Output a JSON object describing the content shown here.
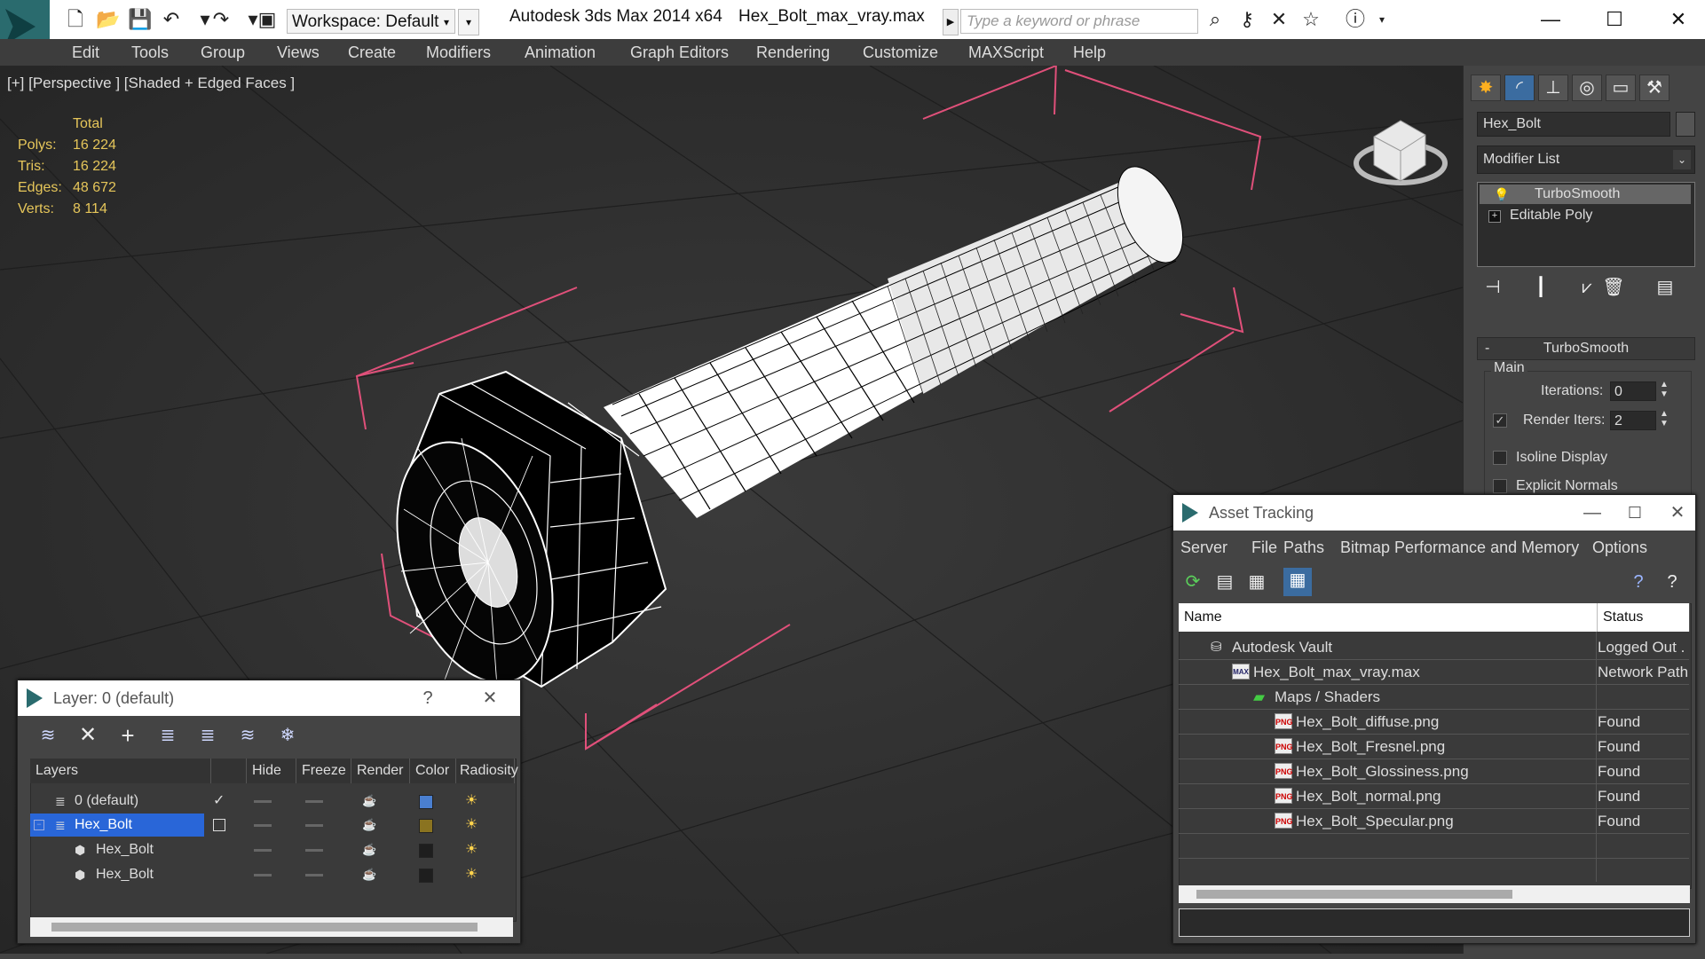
{
  "titlebar": {
    "workspace": "Workspace: Default",
    "app": "Autodesk 3ds Max  2014 x64",
    "file": "Hex_Bolt_max_vray.max",
    "search_placeholder": "Type a keyword or phrase"
  },
  "menu": [
    "Edit",
    "Tools",
    "Group",
    "Views",
    "Create",
    "Modifiers",
    "Animation",
    "Graph Editors",
    "Rendering",
    "Customize",
    "MAXScript",
    "Help"
  ],
  "viewport": {
    "label": "[+] [Perspective ] [Shaded + Edged Faces ]",
    "stats": {
      "header": "Total",
      "rows": [
        {
          "k": "Polys:",
          "v": "16 224"
        },
        {
          "k": "Tris:",
          "v": "16 224"
        },
        {
          "k": "Edges:",
          "v": "48 672"
        },
        {
          "k": "Verts:",
          "v": "8 114"
        }
      ]
    }
  },
  "cmdpanel": {
    "object_name": "Hex_Bolt",
    "modifier_list": "Modifier List",
    "stack": [
      "TurboSmooth",
      "Editable Poly"
    ],
    "rollout": "TurboSmooth",
    "group": "Main",
    "iterations_label": "Iterations:",
    "iterations": "0",
    "render_iters_label": "Render Iters:",
    "render_iters": "2",
    "isoline": "Isoline Display",
    "explicit": "Explicit Normals"
  },
  "layer_dialog": {
    "title": "Layer: 0 (default)",
    "help": "?",
    "columns": [
      "Layers",
      "Hide",
      "Freeze",
      "Render",
      "Color",
      "Radiosity"
    ],
    "rows": [
      {
        "name": "0 (default)",
        "color": "#4a7fd0"
      },
      {
        "name": "Hex_Bolt",
        "color": "#8a7320"
      },
      {
        "name": "Hex_Bolt",
        "color": "#1e1e1e"
      },
      {
        "name": "Hex_Bolt",
        "color": "#1e1e1e"
      }
    ]
  },
  "asset_dialog": {
    "title": "Asset Tracking",
    "menu": [
      "Server",
      "File",
      "Paths",
      "Bitmap Performance and Memory",
      "Options"
    ],
    "columns": [
      "Name",
      "Status"
    ],
    "rows": [
      {
        "name": "Autodesk Vault",
        "status": "Logged Out ."
      },
      {
        "name": "Hex_Bolt_max_vray.max",
        "status": "Network Path"
      },
      {
        "name": "Maps / Shaders",
        "status": ""
      },
      {
        "name": "Hex_Bolt_diffuse.png",
        "status": "Found"
      },
      {
        "name": "Hex_Bolt_Fresnel.png",
        "status": "Found"
      },
      {
        "name": "Hex_Bolt_Glossiness.png",
        "status": "Found"
      },
      {
        "name": "Hex_Bolt_normal.png",
        "status": "Found"
      },
      {
        "name": "Hex_Bolt_Specular.png",
        "status": "Found"
      }
    ],
    "png_badge": "PNG",
    "max_badge": "MAX"
  }
}
